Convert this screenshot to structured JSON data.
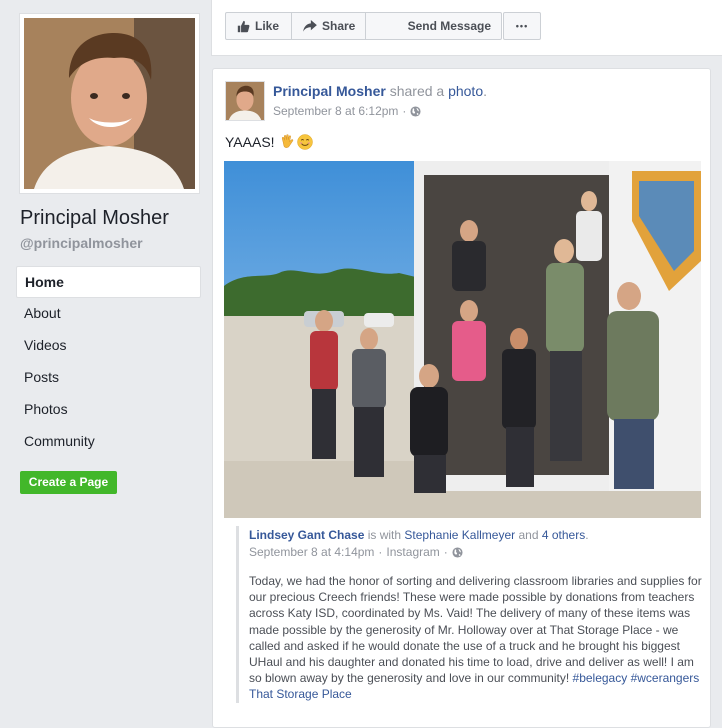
{
  "page": {
    "name": "Principal Mosher",
    "handle": "@principalmosher"
  },
  "nav": {
    "items": [
      "Home",
      "About",
      "Videos",
      "Posts",
      "Photos",
      "Community"
    ],
    "active": "Home"
  },
  "create_page_label": "Create a Page",
  "actions": {
    "like": "Like",
    "share": "Share",
    "send_message": "Send Message",
    "more": "•••"
  },
  "post": {
    "author": "Principal Mosher",
    "action_text": "shared a",
    "photo_link": "photo",
    "timestamp": "September 8 at 6:12pm",
    "sep": "·",
    "text": "YAAAS!",
    "emojis": [
      "waving-hand",
      "smiling-face"
    ]
  },
  "shared": {
    "author": "Lindsey Gant Chase",
    "is_with": "is with",
    "with_name": "Stephanie Kallmeyer",
    "and": "and",
    "others": "4 others",
    "period": ".",
    "timestamp": "September 8 at 4:14pm",
    "source": "Instagram",
    "body": "Today, we had the honor of sorting and delivering classroom libraries and supplies for our precious Creech friends! These were made possible by donations from teachers across Katy ISD, coordinated by Ms. Vaid! The delivery of many of these items was made possible by the generosity of Mr. Holloway over at That Storage Place - we called and asked if he would donate the use of a truck and he brought his biggest UHaul and his daughter and donated his time to load, drive and deliver as well! I am so blown away by the generosity and love in our community!",
    "hashtags": [
      "#belegacy",
      "#wcerangers"
    ],
    "tag_place": "That Storage Place"
  },
  "colors": {
    "link": "#365899",
    "green": "#42b72a",
    "bg": "#e9ebee",
    "muted": "#90949c"
  }
}
